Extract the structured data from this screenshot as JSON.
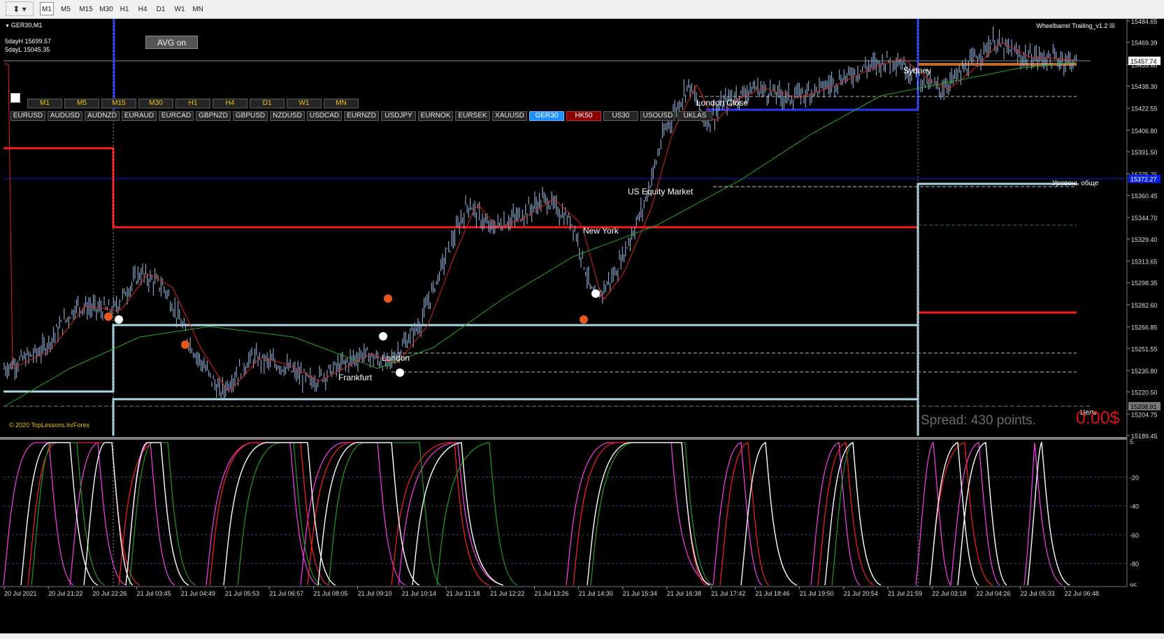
{
  "toolbar": {
    "tool_icon": "line-tools-icon",
    "timeframes": [
      "M1",
      "M5",
      "M15",
      "M30",
      "H1",
      "H4",
      "D1",
      "W1",
      "MN"
    ],
    "active": "M1"
  },
  "chart": {
    "symbol_title": "GER30,M1",
    "indicator_name": "Wheelbarrel Trailing_v1.2",
    "sday_high": "5dayH 15699.57",
    "sday_low": "5dayL 15045.35",
    "avg_button": "AVG  on",
    "copyright": "© 2020 TopLessons.In/Forex",
    "spread": "Spread: 430 points.",
    "profit": "0.00$",
    "session_labels": [
      "London Close",
      "US Equity Market",
      "New York",
      "London",
      "Frankfurt",
      "Sydney"
    ],
    "level_label": "Уровень обще",
    "target_label": "Цель",
    "price_labels": [
      "15457.74",
      "15372.27",
      "15208.91"
    ]
  },
  "panel": {
    "timeframe_buttons": [
      "M1",
      "M5",
      "M15",
      "M30",
      "H1",
      "H4",
      "D1",
      "W1",
      "MN"
    ],
    "symbols": [
      "EURUSD",
      "AUDUSD",
      "AUDNZD",
      "EURAUD",
      "EURCAD",
      "GBPNZD",
      "GBPUSD",
      "NZDUSD",
      "USDCAD",
      "EURNZD",
      "USDJPY",
      "EURNOK",
      "EURSEK",
      "XAUUSD",
      "GER30",
      "HK50",
      "US30",
      "USOUSD",
      "UKLAS"
    ],
    "active_symbol": "GER30",
    "alert_symbol": "HK50"
  },
  "price_axis": [
    "15484.65",
    "15469.39",
    "15453.60",
    "15438.30",
    "15422.55",
    "15406.80",
    "15391.50",
    "15375.75",
    "15360.45",
    "15344.70",
    "15329.40",
    "15313.65",
    "15298.35",
    "15282.60",
    "15266.85",
    "15251.55",
    "15235.80",
    "15220.50",
    "15204.75",
    "15189.45"
  ],
  "oscillator_axis": [
    "5",
    "-20",
    "-40",
    "-60",
    "-80",
    "95"
  ],
  "time_axis": [
    "20 Jul 2021",
    "20 Jul 21:22",
    "20 Jul 22:26",
    "21 Jul 03:45",
    "21 Jul 04:49",
    "21 Jul 05:53",
    "21 Jul 06:57",
    "21 Jul 08:05",
    "21 Jul 09:10",
    "21 Jul 10:14",
    "21 Jul 11:18",
    "21 Jul 12:22",
    "21 Jul 13:26",
    "21 Jul 14:30",
    "21 Jul 15:34",
    "21 Jul 16:38",
    "21 Jul 17:42",
    "21 Jul 18:46",
    "21 Jul 19:50",
    "21 Jul 20:54",
    "21 Jul 21:59",
    "22 Jul 03:18",
    "22 Jul 04:26",
    "22 Jul 05:33",
    "22 Jul 06:48"
  ],
  "colors": {
    "background": "#000000",
    "candles": "#8fb0d8",
    "ma_slow": "#22aa22",
    "ma_fast": "#dd2222",
    "box": "#add8e6",
    "resistance": "#ff0000",
    "session_blue": "#1e3cff"
  }
}
